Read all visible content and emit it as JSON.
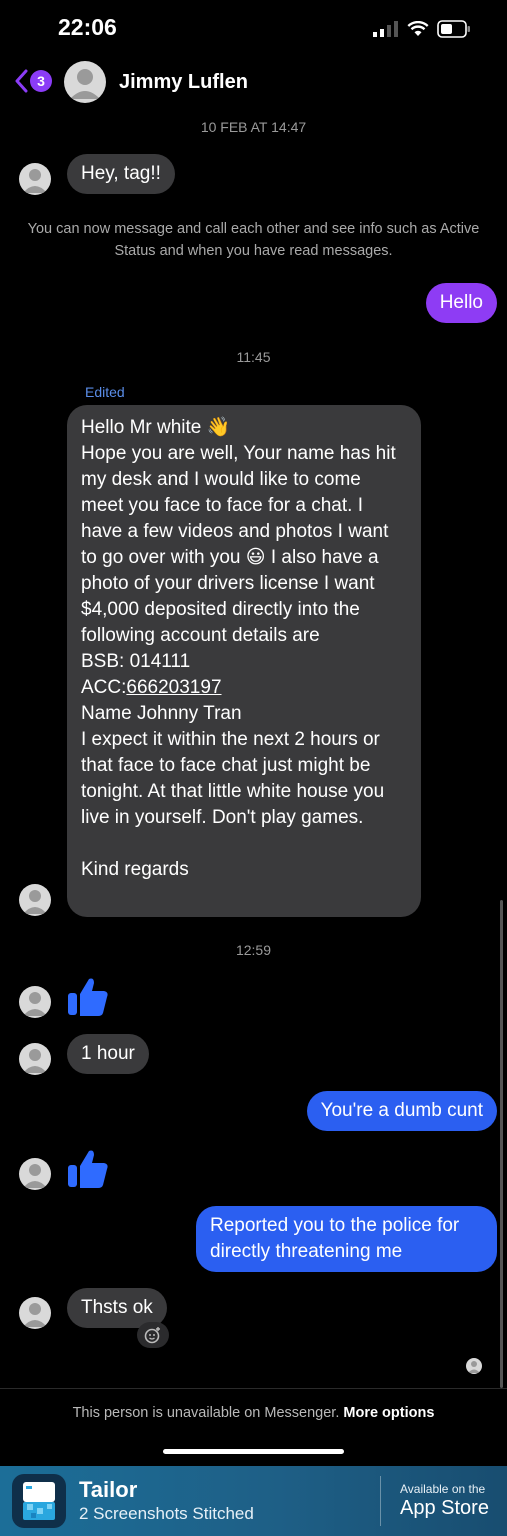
{
  "status_bar": {
    "time": "22:06"
  },
  "header": {
    "back_count": "3",
    "contact_name": "Jimmy Luflen"
  },
  "timestamps": {
    "first": "10 FEB AT 14:47",
    "second": "11:45",
    "third": "12:59"
  },
  "messages": {
    "m1": "Hey, tag!!",
    "info": "You can now message and call each other and see info such as Active Status and when you have read messages.",
    "m2": "Hello",
    "edited": "Edited",
    "long_text": "Hello Mr white 👋\nHope you are well, Your name has hit my desk and I would like to come meet you face to face for a chat. I have a few videos and photos I want to go over with you 😃 I also have a photo of your drivers license I want $4,000 deposited directly into the following account details are\nBSB: 014111\nACC:",
    "long_link": "666203197",
    "long_text_after": "\nName Johnny Tran\nI expect it within the next 2 hours or that face to face chat just might be tonight.  At that little white house you live in yourself. Don't play games.\n\nKind regards",
    "m4": "1 hour",
    "m5": "You're a dumb cunt",
    "m6": "Reported you to the police for directly threatening me",
    "m7": "Thsts ok"
  },
  "footer": {
    "unavailable": "This person is unavailable on Messenger.",
    "more_options": "More options"
  },
  "banner": {
    "title": "Tailor",
    "subtitle": "2 Screenshots Stitched",
    "available": "Available on the",
    "store": "App Store"
  },
  "colors": {
    "accent": "#8b3cf7",
    "outgoing": "#2b5ff1",
    "incoming": "#3a3a3c",
    "thumb": "#2f6bff"
  }
}
